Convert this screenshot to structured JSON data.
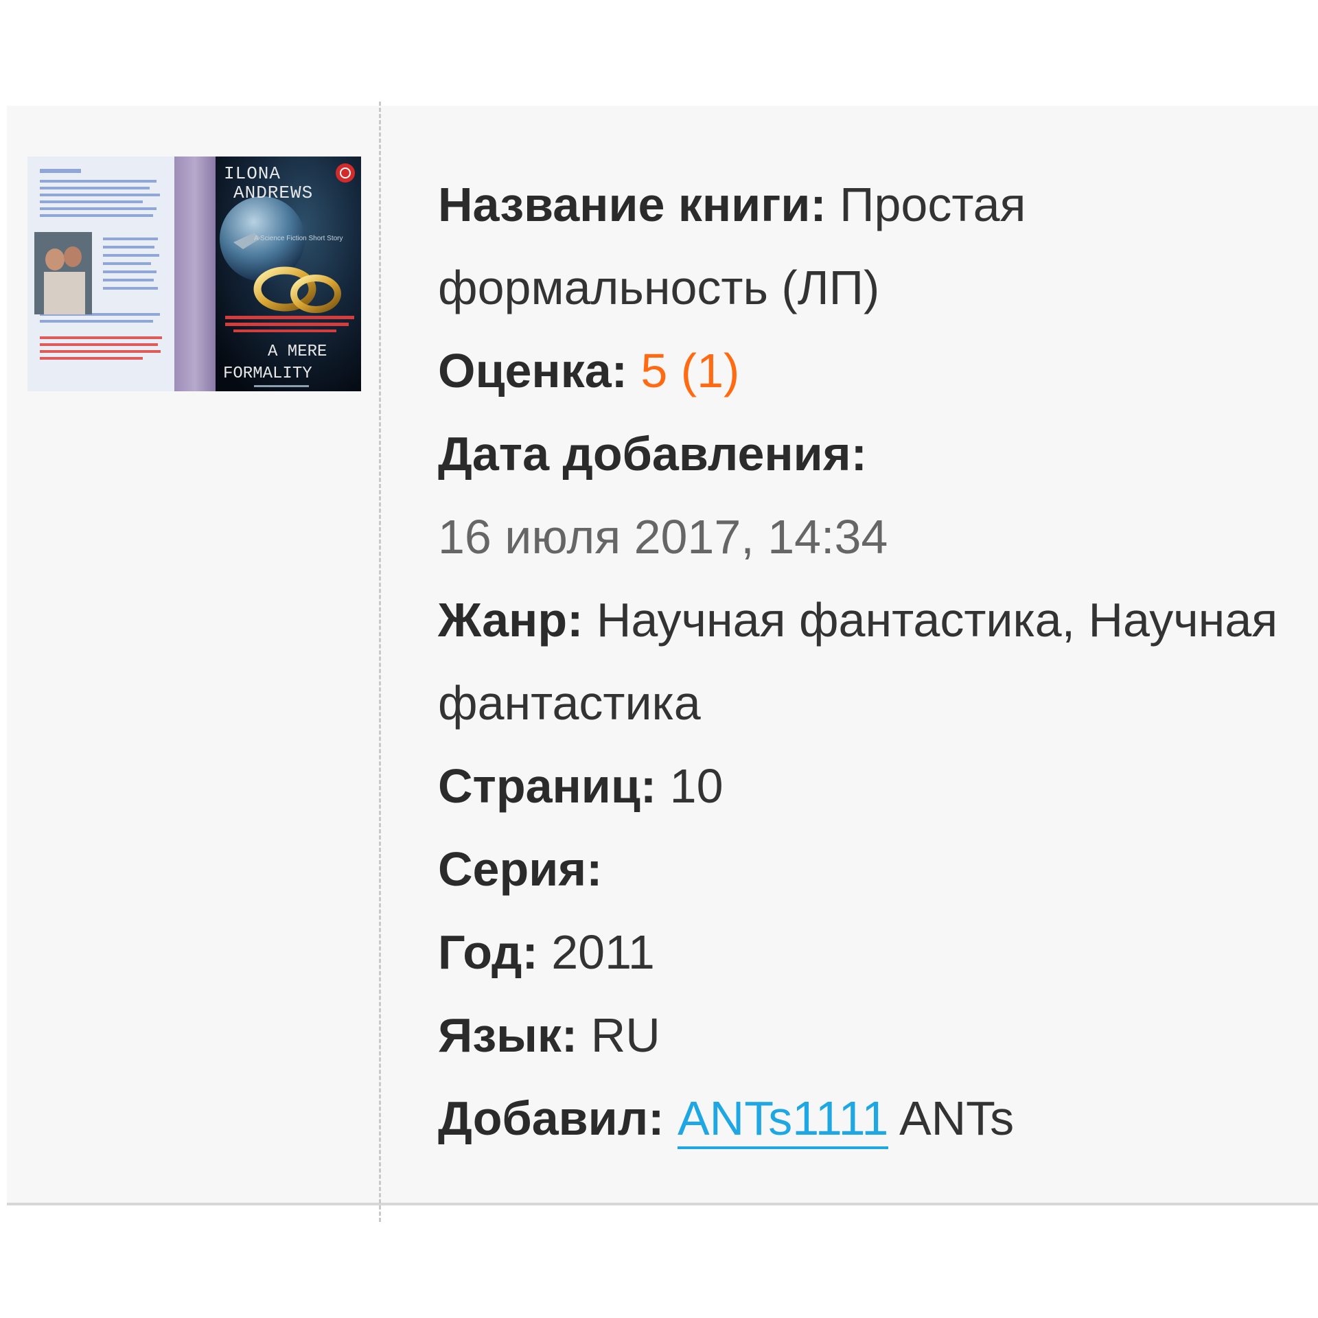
{
  "book": {
    "cover": {
      "author_top": "ILONA",
      "author_bottom": "ANDREWS",
      "subtitle": "A Science Fiction Short Story",
      "title_top": "A MERE",
      "title_bottom": "FORMALITY",
      "alt": "Обложка книги"
    },
    "fields": {
      "title_label": "Название книги:",
      "title_value": "Простая формальность (ЛП)",
      "rating_label": "Оценка:",
      "rating_value": "5 (1)",
      "date_label": "Дата добавления:",
      "date_value": "16 июля 2017, 14:34",
      "genre_label": "Жанр:",
      "genre_value": "Научная фантастика, Научная фантастика",
      "pages_label": "Страниц:",
      "pages_value": "10",
      "series_label": "Серия:",
      "series_value": "",
      "year_label": "Год:",
      "year_value": "2011",
      "language_label": "Язык:",
      "language_value": "RU",
      "added_by_label": "Добавил:",
      "added_by_login": "ANTs1111",
      "added_by_name": "ANTs"
    }
  },
  "colors": {
    "accent_rating": "#ff6a13",
    "link": "#1ea7e3",
    "label": "#2b2b2b",
    "date": "#666666",
    "card_bg": "#f7f7f7"
  }
}
